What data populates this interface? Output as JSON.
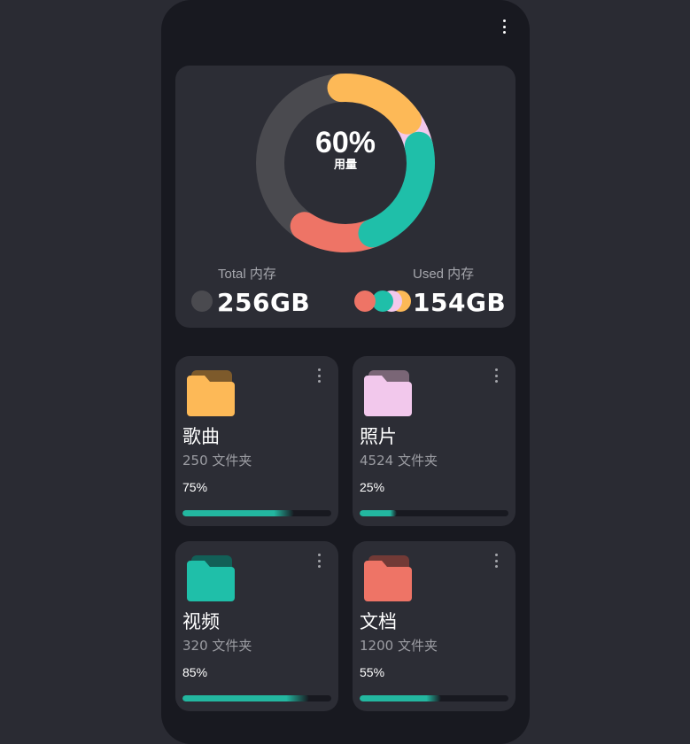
{
  "colors": {
    "songs": "#fdb957",
    "photos": "#f2c8ec",
    "videos": "#1fbfa9",
    "docs": "#ee7466",
    "free": "#4a4a4f",
    "progress": "#23b7a0"
  },
  "storage": {
    "percent_text": "60%",
    "usage_label": "用量",
    "usage_fraction": 0.6,
    "total_label": "Total 内存",
    "total_value": "256GB",
    "used_label": "Used 内存",
    "used_value": "154GB"
  },
  "categories": [
    {
      "key": "songs",
      "title": "歌曲",
      "count": "250 文件夹",
      "percent_text": "75%",
      "progress": 0.75,
      "color": "#fdb957",
      "back_color": "#7d5a2b"
    },
    {
      "key": "photos",
      "title": "照片",
      "count": "4524 文件夹",
      "percent_text": "25%",
      "progress": 0.25,
      "color": "#f2c8ec",
      "back_color": "#7a6676"
    },
    {
      "key": "videos",
      "title": "视频",
      "count": "320 文件夹",
      "percent_text": "85%",
      "progress": 0.85,
      "color": "#1fbfa9",
      "back_color": "#125f57"
    },
    {
      "key": "docs",
      "title": "文档",
      "count": "1200 文件夹",
      "percent_text": "55%",
      "progress": 0.55,
      "color": "#ee7466",
      "back_color": "#723a36"
    }
  ]
}
